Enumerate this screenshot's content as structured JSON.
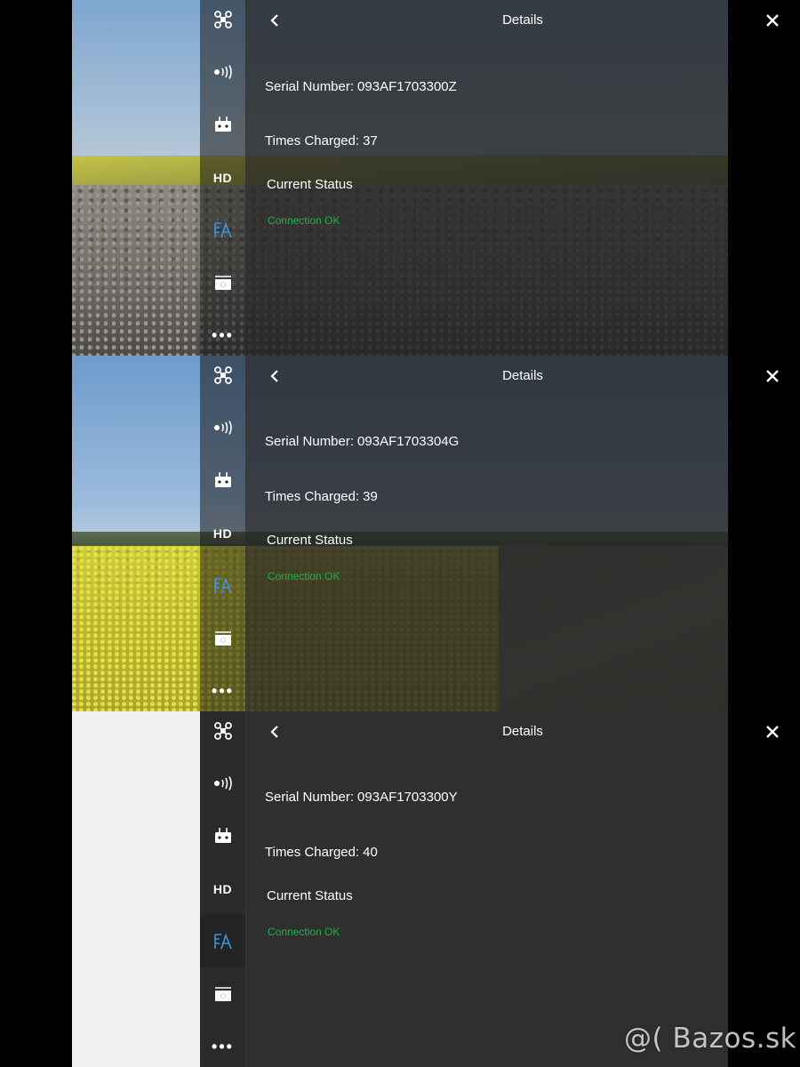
{
  "panels": [
    {
      "header": {
        "title": "Details"
      },
      "serial_label": "Serial Number:",
      "serial_value": "093AF1703300Z",
      "charged_label": "Times Charged:",
      "charged_value": "37",
      "status_heading": "Current Status",
      "status_value": "Connection OK"
    },
    {
      "header": {
        "title": "Details"
      },
      "serial_label": "Serial Number:",
      "serial_value": "093AF1703304G",
      "charged_label": "Times Charged:",
      "charged_value": "39",
      "status_heading": "Current Status",
      "status_value": "Connection OK"
    },
    {
      "header": {
        "title": "Details"
      },
      "serial_label": "Serial Number:",
      "serial_value": "093AF1703300Y",
      "charged_label": "Times Charged:",
      "charged_value": "40",
      "status_heading": "Current Status",
      "status_value": "Connection OK"
    }
  ],
  "sidebar": {
    "items": [
      {
        "icon": "drone-icon"
      },
      {
        "icon": "signal-icon"
      },
      {
        "icon": "remote-controller-icon"
      },
      {
        "icon": "hd-icon",
        "label": "HD"
      },
      {
        "icon": "battery-settings-icon",
        "active": true
      },
      {
        "icon": "camera-icon"
      },
      {
        "icon": "more-icon",
        "label": "•••"
      }
    ]
  },
  "colors": {
    "accent": "#3a96e6",
    "status_ok": "#22b14c"
  },
  "watermark": "@( Bazos.sk"
}
